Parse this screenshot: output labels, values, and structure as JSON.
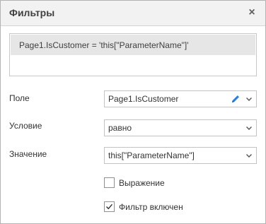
{
  "dialog": {
    "title": "Фильтры",
    "close_glyph": "×",
    "close_icon": "close-icon"
  },
  "filters": [
    {
      "text": "Page1.IsCustomer = 'this[\"ParameterName\"]'"
    }
  ],
  "form": {
    "field_label": "Поле",
    "field_value": "Page1.IsCustomer",
    "field_icons": [
      "pencil-icon",
      "chevron-down-icon"
    ],
    "condition_label": "Условие",
    "condition_value": "равно",
    "value_label": "Значение",
    "value_value": "this[\"ParameterName\"]",
    "expression_label": "Выражение",
    "expression_checked": false,
    "filter_enabled_label": "Фильтр включен",
    "filter_enabled_checked": true
  },
  "colors": {
    "titlebar": "#f2f2f2",
    "selected_row": "#e6e6e6",
    "pencil": "#2f7fd8",
    "border": "#c3c3c3"
  }
}
